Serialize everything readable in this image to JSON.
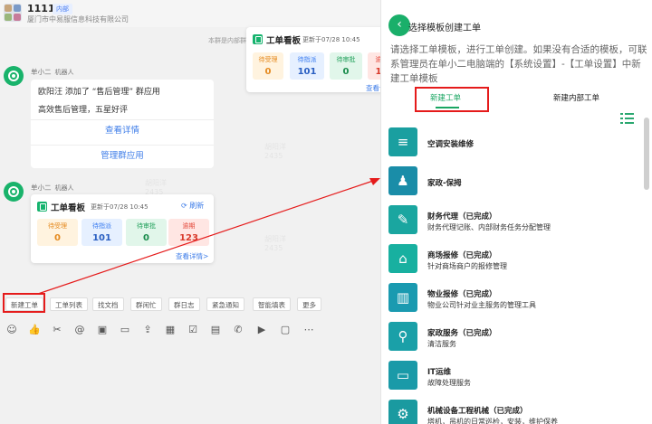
{
  "group": {
    "title": "1111",
    "badge": "内部",
    "org": "厦门市中易服信息科技有限公司"
  },
  "system_message": "本群是内部群",
  "bot": {
    "name": "单小二",
    "tag": "机器人"
  },
  "message": {
    "line1": "欧阳汪 添加了 “售后管理” 群应用",
    "line2": "高效售后管理，五星好评",
    "link1": "查看详情",
    "link2": "管理群应用"
  },
  "kanban": {
    "title": "工单看板",
    "updated": "更新于07/28 10:45",
    "refresh": "刷新",
    "more": "查看详情>",
    "more_short": "查看详",
    "cells": [
      {
        "label": "待受理",
        "value": "0"
      },
      {
        "label": "待指派",
        "value": "101"
      },
      {
        "label": "待审批",
        "value": "0"
      },
      {
        "label": "逾期",
        "value": "123"
      }
    ],
    "top_cells": [
      {
        "label": "待受理",
        "value": "0"
      },
      {
        "label": "待指派",
        "value": "101"
      },
      {
        "label": "待审批",
        "value": "0"
      },
      {
        "label": "逾",
        "value": "1"
      }
    ]
  },
  "quick_buttons": [
    "新建工单",
    "工单列表",
    "找文档",
    "群闲忙",
    "群日志",
    "紧急通知",
    "智能填表",
    "更多"
  ],
  "toolbar_icons": [
    "smile-icon",
    "thumb-icon",
    "scissors-icon",
    "at-icon",
    "image-icon",
    "folder-icon",
    "upload-icon",
    "calendar-icon",
    "checklist-icon",
    "task-icon",
    "phone-icon",
    "video-icon",
    "more-icon"
  ],
  "panel": {
    "title": "选择模板创建工单",
    "description": "请选择工单模板，进行工单创建。如果没有合适的模板，可联系管理员在单小二电脑端的【系统设置】-【工单设置】中新建工单模板",
    "tabs": [
      "新建工单",
      "新建内部工单"
    ],
    "templates": [
      {
        "name": "空调安装维修",
        "desc": "",
        "icon": "ac-icon",
        "color": "#1aa6a0"
      },
      {
        "name": "家政-保拇",
        "desc": "",
        "icon": "housekeeping-icon",
        "color": "#1aa6a0"
      },
      {
        "name": "财务代理（已完成）",
        "desc": "财务代理记账、内部财务任务分配管理",
        "icon": "finance-icon",
        "color": "#1aa6a0"
      },
      {
        "name": "商场报修（已完成）",
        "desc": "针对商场商户的报修管理",
        "icon": "store-icon",
        "color": "#1aa6a0"
      },
      {
        "name": "物业报修（已完成）",
        "desc": "物业公司针对业主服务的管理工具",
        "icon": "building-icon",
        "color": "#1aa6a0"
      },
      {
        "name": "家政服务（已完成）",
        "desc": "清洁服务",
        "icon": "broom-icon",
        "color": "#1aa6a0"
      },
      {
        "name": "IT运维",
        "desc": "故障处理服务",
        "icon": "computer-icon",
        "color": "#1aa6a0"
      },
      {
        "name": "机械设备工程机械（已完成）",
        "desc": "塔机，吊机的日常巡检，安装，维护保养",
        "icon": "machine-icon",
        "color": "#1aa6a0"
      }
    ]
  },
  "watermark": "胡阳洋 2435"
}
